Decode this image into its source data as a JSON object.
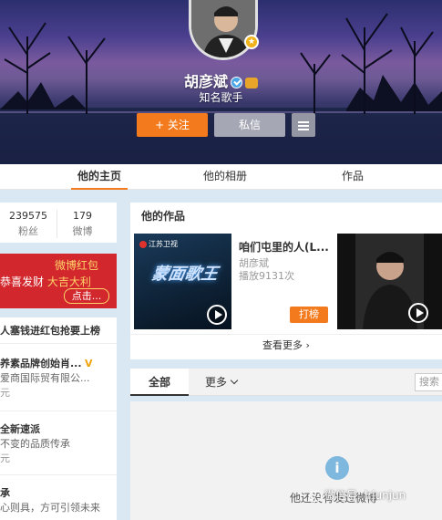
{
  "profile": {
    "name": "胡彦斌",
    "description": "知名歌手",
    "follow_label": "+ 关注",
    "message_label": "私信"
  },
  "tabs": [
    {
      "label": "他的主页",
      "active": true
    },
    {
      "label": "他的相册",
      "active": false
    },
    {
      "label": "作品",
      "active": false
    }
  ],
  "stats": {
    "fans_count": "239575",
    "fans_label": "粉丝",
    "weibo_count": "179",
    "weibo_label": "微博"
  },
  "redpack": {
    "title": "微博红包",
    "subtitle_a": "恭喜发财",
    "subtitle_b": "大吉大利",
    "button": "点击..."
  },
  "sidebar": {
    "items": [
      {
        "text": "人塞钱进红包抢要上榜"
      },
      {
        "title": "养素品牌创始肖...",
        "sub": "爱商国际贸有限公...",
        "meta": "元"
      },
      {
        "title": "全新速派",
        "sub": "不变的品质传承",
        "meta": "元"
      },
      {
        "title": "承",
        "sub": "心则具，方可引领未来"
      }
    ]
  },
  "works": {
    "title": "他的作品",
    "items": [
      {
        "brand": "江苏卫视",
        "show_title": "蒙面歌王",
        "song": "咱们屯里的人(L...",
        "artist": "胡彦斌",
        "plays": "播放9131次",
        "action": "打榜"
      }
    ],
    "see_more": "查看更多"
  },
  "feed": {
    "all_label": "全部",
    "more_label": "更多",
    "search_placeholder": "搜索",
    "empty_text": "他还没有发过微博",
    "watermark": "微信号: lrjunjun"
  },
  "colors": {
    "accent": "#f37b1d",
    "red_pack": "#d2272c",
    "page_bg": "#d9e8f2"
  }
}
